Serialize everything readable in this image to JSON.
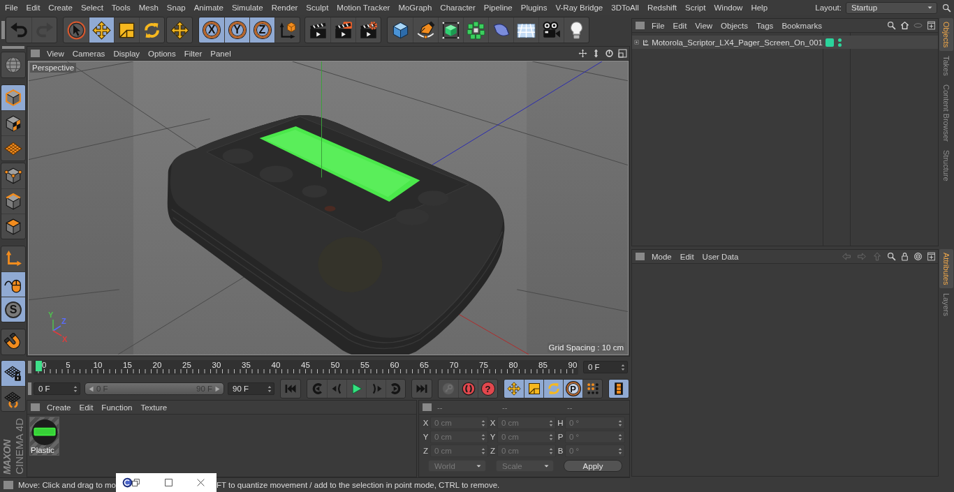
{
  "menu_bar": {
    "items": [
      "File",
      "Edit",
      "Create",
      "Select",
      "Tools",
      "Mesh",
      "Snap",
      "Animate",
      "Simulate",
      "Render",
      "Sculpt",
      "Motion Tracker",
      "MoGraph",
      "Character",
      "Pipeline",
      "Plugins",
      "V-Ray Bridge",
      "3DToAll",
      "Redshift",
      "Script",
      "Window",
      "Help"
    ],
    "layout_label": "Layout:",
    "layout_value": "Startup"
  },
  "toolbar": {
    "groups": [
      {
        "buttons": [
          {
            "kind": "undo",
            "selected": false,
            "disabled": false
          },
          {
            "kind": "redo",
            "selected": false,
            "disabled": true
          }
        ]
      },
      {
        "buttons": [
          {
            "kind": "select",
            "selected": false,
            "disabled": false
          },
          {
            "kind": "move",
            "selected": true,
            "disabled": false
          },
          {
            "kind": "scale",
            "selected": false,
            "disabled": false
          },
          {
            "kind": "rotate",
            "selected": false,
            "disabled": false
          }
        ]
      },
      {
        "buttons": [
          {
            "kind": "move",
            "selected": false,
            "disabled": false
          }
        ]
      },
      {
        "buttons": [
          {
            "kind": "axis",
            "label": "X",
            "selected": true,
            "disabled": false
          },
          {
            "kind": "axis",
            "label": "Y",
            "selected": true,
            "disabled": false
          },
          {
            "kind": "axis",
            "label": "Z",
            "selected": true,
            "disabled": false
          },
          {
            "kind": "coordinates",
            "selected": false,
            "disabled": false
          }
        ]
      },
      {
        "buttons": [
          {
            "kind": "render",
            "selected": false,
            "disabled": false
          },
          {
            "kind": "viewer",
            "selected": false,
            "disabled": false
          },
          {
            "kind": "settings",
            "selected": false,
            "disabled": false
          }
        ]
      },
      {
        "buttons": [
          {
            "kind": "cube",
            "selected": false,
            "disabled": false
          },
          {
            "kind": "pen",
            "selected": false,
            "disabled": false
          },
          {
            "kind": "subdivide",
            "selected": false,
            "disabled": false
          },
          {
            "kind": "cloner",
            "selected": false,
            "disabled": false
          },
          {
            "kind": "bend",
            "selected": false,
            "disabled": false
          },
          {
            "kind": "floor",
            "selected": false,
            "disabled": false
          },
          {
            "kind": "camera",
            "selected": false,
            "disabled": false
          },
          {
            "kind": "light",
            "selected": false,
            "disabled": false
          }
        ]
      }
    ]
  },
  "left_toolbar": {
    "groups": [
      {
        "buttons": [
          {
            "kind": "editable",
            "selected": false
          }
        ]
      },
      {
        "buttons": [
          {
            "kind": "model",
            "selected": true
          },
          {
            "kind": "texture",
            "selected": false
          },
          {
            "kind": "workplane",
            "selected": false
          }
        ]
      },
      {
        "buttons": [
          {
            "kind": "points",
            "selected": false
          },
          {
            "kind": "edges",
            "selected": false
          },
          {
            "kind": "polygons",
            "selected": false
          }
        ]
      },
      {
        "buttons": [
          {
            "kind": "axismode",
            "selected": false
          },
          {
            "kind": "tweak",
            "selected": true
          },
          {
            "kind": "solo",
            "label": "S",
            "selected": true
          }
        ]
      },
      {
        "buttons": [
          {
            "kind": "snap",
            "selected": false
          }
        ]
      },
      {
        "buttons": [
          {
            "kind": "planelock",
            "selected": true
          },
          {
            "kind": "planemode",
            "selected": false
          }
        ]
      }
    ]
  },
  "logo": {
    "brand": "MAXON",
    "product": "CINEMA 4D"
  },
  "viewport": {
    "menu": [
      "View",
      "Cameras",
      "Display",
      "Options",
      "Filter",
      "Panel"
    ],
    "camera_label": "Perspective",
    "grid_spacing": "Grid Spacing : 10 cm",
    "axis_gizmo": [
      {
        "label": "Y",
        "color": "#4fc04f"
      },
      {
        "label": "Z",
        "color": "#5a6cff"
      },
      {
        "label": "X",
        "color": "#e03c3c"
      }
    ]
  },
  "timeline": {
    "labels": [
      "0",
      "5",
      "10",
      "15",
      "20",
      "25",
      "30",
      "35",
      "40",
      "45",
      "50",
      "55",
      "60",
      "65",
      "70",
      "75",
      "80",
      "85",
      "90"
    ],
    "level": 0,
    "frame_field": "0 F"
  },
  "playback": {
    "start_field": "0 F",
    "range": {
      "start": "0 F",
      "end": "90 F"
    },
    "end_field": "90 F",
    "groups": [
      {
        "buttons": [
          {
            "kind": "start",
            "selected": false,
            "disabled": false
          }
        ]
      },
      {
        "buttons": [
          {
            "kind": "prevkey",
            "selected": false,
            "disabled": false
          },
          {
            "kind": "prevframe",
            "selected": false,
            "disabled": false
          },
          {
            "kind": "play",
            "selected": false,
            "disabled": false
          },
          {
            "kind": "nextframe",
            "selected": false,
            "disabled": false
          },
          {
            "kind": "nextkey",
            "selected": false,
            "disabled": false
          }
        ]
      },
      {
        "buttons": [
          {
            "kind": "end",
            "selected": false,
            "disabled": false
          }
        ]
      },
      {
        "buttons": [
          {
            "kind": "recordkey",
            "selected": false,
            "disabled": true
          },
          {
            "kind": "autokey",
            "selected": false,
            "disabled": false
          },
          {
            "kind": "keyframe",
            "label": "?",
            "selected": false,
            "disabled": false
          }
        ]
      },
      {
        "buttons": [
          {
            "kind": "move",
            "selected": true,
            "disabled": false
          },
          {
            "kind": "scale",
            "selected": true,
            "disabled": false
          },
          {
            "kind": "rotate",
            "selected": true,
            "disabled": false
          },
          {
            "kind": "param",
            "label": "P",
            "selected": true,
            "disabled": false
          },
          {
            "kind": "dots",
            "selected": false,
            "disabled": false
          }
        ]
      },
      {
        "buttons": [
          {
            "kind": "timeline",
            "selected": true,
            "disabled": false
          }
        ]
      }
    ]
  },
  "material_manager": {
    "menu": [
      "Create",
      "Edit",
      "Function",
      "Texture"
    ],
    "materials": [
      {
        "name": "Plastic"
      }
    ]
  },
  "coordinates": {
    "headers": [
      "--",
      "--",
      "--"
    ],
    "rows": [
      [
        {
          "label": "X",
          "value": "0 cm"
        },
        {
          "label": "X",
          "value": "0 cm"
        },
        {
          "label": "H",
          "value": "0 °"
        }
      ],
      [
        {
          "label": "Y",
          "value": "0 cm"
        },
        {
          "label": "Y",
          "value": "0 cm"
        },
        {
          "label": "P",
          "value": "0 °"
        }
      ],
      [
        {
          "label": "Z",
          "value": "0 cm"
        },
        {
          "label": "Z",
          "value": "0 cm"
        },
        {
          "label": "B",
          "value": "0 °"
        }
      ]
    ],
    "dropdowns": [
      "World",
      "Scale"
    ],
    "apply": "Apply",
    "disabled": true
  },
  "status_bar": {
    "text_start": "Move: Click and drag to mo",
    "text_end": "FT to quantize movement / add to the selection in point mode, CTRL to remove."
  },
  "object_manager": {
    "menu": [
      "File",
      "Edit",
      "View",
      "Objects",
      "Tags",
      "Bookmarks"
    ],
    "objects": [
      {
        "name": "Motorola_Scriptor_LX4_Pager_Screen_On_001",
        "expanded": false,
        "color": "#2bd49c",
        "editor_visible": true,
        "render_visible": true
      }
    ]
  },
  "side_tabs_top": [
    {
      "label": "Objects",
      "selected": true
    },
    {
      "label": "Takes",
      "selected": false
    },
    {
      "label": "Content Browser",
      "selected": false
    },
    {
      "label": "Structure",
      "selected": false
    }
  ],
  "attributes": {
    "menu": [
      "Mode",
      "Edit",
      "User Data"
    ],
    "nav_buttons": [
      {
        "kind": "back",
        "disabled": true
      },
      {
        "kind": "forward",
        "disabled": true
      },
      {
        "kind": "up",
        "disabled": true
      }
    ]
  },
  "side_tabs_bottom": [
    {
      "label": "Attributes",
      "selected": true
    },
    {
      "label": "Layers",
      "selected": false
    }
  ]
}
